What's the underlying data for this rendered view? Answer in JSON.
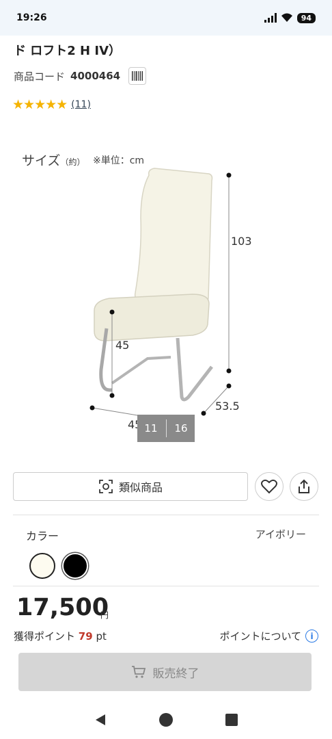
{
  "status_bar": {
    "time": "19:26",
    "battery": "94"
  },
  "product": {
    "title_partial": "ド ロフト2 H IV）",
    "code_label": "商品コード",
    "code_value": "4000464",
    "review_count": "(11)",
    "rating_stars": 5
  },
  "image": {
    "size_label": "サイズ",
    "size_paren": "（約）",
    "unit_note": "※単位：cm",
    "dims": {
      "height": "103",
      "seat_height": "45",
      "width": "45",
      "depth": "53.5"
    },
    "counter": {
      "current": "11",
      "total": "16"
    }
  },
  "actions": {
    "similar_label": "類似商品"
  },
  "color": {
    "label": "カラー",
    "selected": "アイボリー",
    "swatches": [
      "#fdfbf0",
      "#000000"
    ]
  },
  "price": {
    "amount": "17,500",
    "currency": "円"
  },
  "points": {
    "label": "獲得ポイント",
    "value": "79",
    "unit": "pt",
    "about": "ポイントについて"
  },
  "purchase": {
    "soldout_label": "販売終了"
  }
}
